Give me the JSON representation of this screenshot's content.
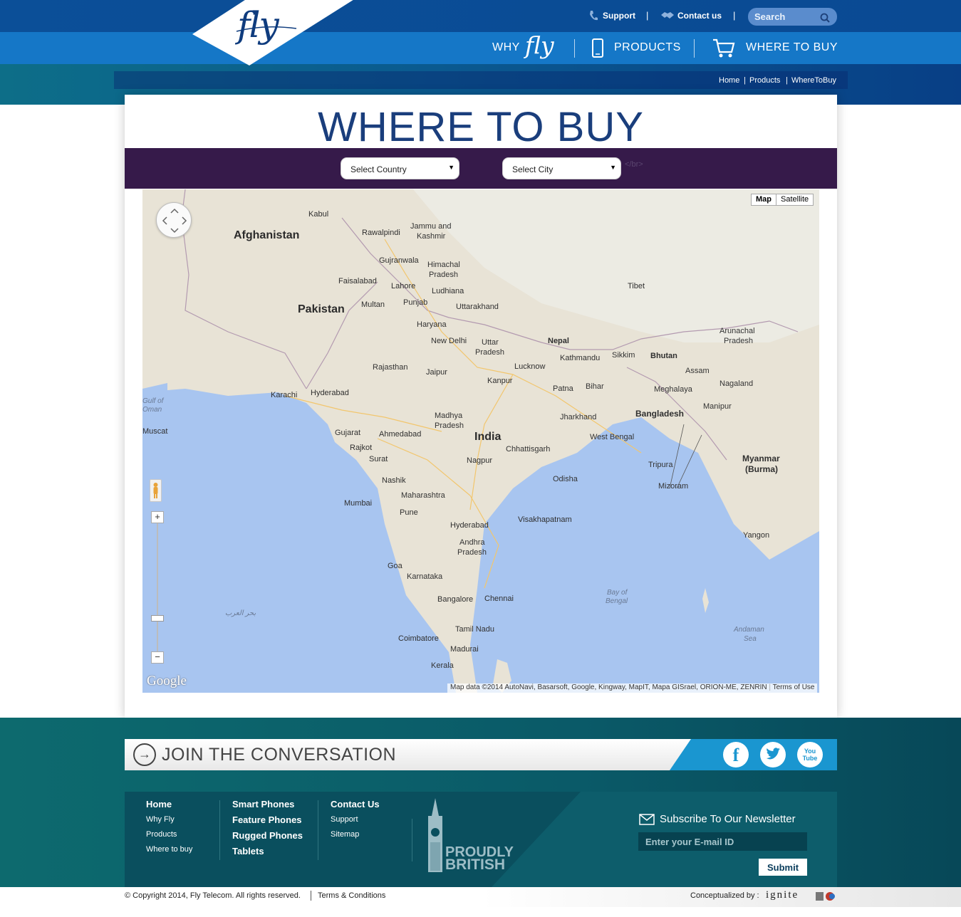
{
  "header": {
    "logo_text": "fly",
    "top_links": [
      {
        "label": "Support",
        "icon": "phone-icon"
      },
      {
        "label": "Contact us",
        "icon": "handshake-icon"
      }
    ],
    "search_placeholder": "Search",
    "nav": [
      {
        "label": "WHY",
        "logo": "fly"
      },
      {
        "label": "PRODUCTS",
        "icon": "mobile-phone-icon"
      },
      {
        "label": "WHERE TO BUY",
        "icon": "shopping-cart-icon"
      }
    ]
  },
  "breadcrumb": [
    "Home",
    "Products",
    "WhereToBuy"
  ],
  "main": {
    "title": "WHERE TO BUY",
    "select_country": "Select Country",
    "select_city": "Select City",
    "stray_text": "</br>"
  },
  "map": {
    "type_buttons": [
      "Map",
      "Satellite"
    ],
    "brand": "Google",
    "attribution": "Map data ©2014 AutoNavi, Basarsoft, Google, Kingway, MapIT, Mapa GISrael, ORION-ME, ZENRIN",
    "terms": "Terms of Use",
    "zoom_in": "+",
    "zoom_out": "−",
    "countries": [
      "Afghanistan",
      "Pakistan",
      "India",
      "Nepal",
      "Bhutan",
      "Bangladesh",
      "Myanmar",
      "(Burma)",
      "Tibet"
    ],
    "regions": [
      "Jammu and",
      "Kashmir",
      "Himachal",
      "Pradesh",
      "Punjab",
      "Uttarakhand",
      "Haryana",
      "Uttar",
      "Pradesh",
      "Rajasthan",
      "Gujarat",
      "Madhya",
      "Pradesh",
      "Bihar",
      "Jharkhand",
      "West Bengal",
      "Chhattisgarh",
      "Odisha",
      "Maharashtra",
      "Andhra",
      "Pradesh",
      "Karnataka",
      "Tamil Nadu",
      "Kerala",
      "Goa",
      "Sikkim",
      "Assam",
      "Meghalaya",
      "Nagaland",
      "Manipur",
      "Tripura",
      "Mizoram",
      "Arunachal",
      "Pradesh"
    ],
    "cities": [
      "Kabul",
      "Rawalpindi",
      "Gujranwala",
      "Faisalabad",
      "Lahore",
      "Ludhiana",
      "Multan",
      "New Delhi",
      "Jaipur",
      "Lucknow",
      "Kanpur",
      "Kathmandu",
      "Patna",
      "Karachi",
      "Hyderabad",
      "Ahmedabad",
      "Rajkot",
      "Surat",
      "Nagpur",
      "Nashik",
      "Mumbai",
      "Pune",
      "Hyderabad",
      "Visakhapatnam",
      "Bangalore",
      "Chennai",
      "Coimbatore",
      "Madurai",
      "Yangon",
      "Muscat"
    ],
    "water": [
      "Bay of",
      "Bengal",
      "Andaman",
      "Sea",
      "بحر العرب",
      "Gulf of",
      "Oman"
    ]
  },
  "footer": {
    "join_text": "JOIN THE CONVERSATION",
    "social": [
      "f",
      "t",
      "You Tube"
    ],
    "col1": {
      "heading": "Home",
      "links": [
        "Why Fly",
        "Products",
        "Where to buy"
      ]
    },
    "col2": [
      "Smart Phones",
      "Feature Phones",
      "Rugged Phones",
      "Tablets"
    ],
    "col3": {
      "heading": "Contact Us",
      "links": [
        "Support",
        "Sitemap"
      ]
    },
    "proudly": [
      "PROUDLY",
      "BRITISH"
    ],
    "newsletter_title": "Subscribe To Our Newsletter",
    "email_placeholder": "Enter your E-mail ID",
    "submit": "Submit",
    "copyright": "© Copyright 2014, Fly Telecom. All rights reserved.",
    "terms": "Terms & Conditions",
    "conceptualized": "Conceptualized by :",
    "ignite": "ignite"
  },
  "colors": {
    "header_dark": "#0a4a93",
    "nav_blue": "#1577c7",
    "filter_purple": "#361a4a",
    "title_navy": "#1a3e7c",
    "footer_teal": "#0a5a68",
    "social_blue": "#1a96d0"
  }
}
